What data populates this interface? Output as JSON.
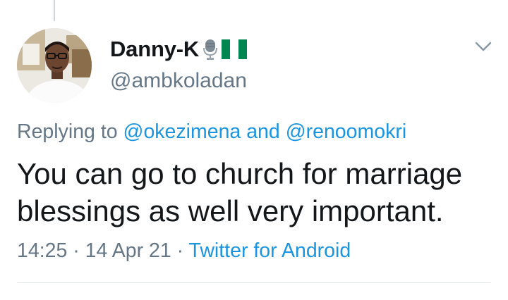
{
  "tweet": {
    "author": {
      "display_name": "Danny-K",
      "name_emojis": [
        "microphone-icon",
        "nigeria-flag-icon"
      ],
      "handle": "@ambkoladan"
    },
    "replying_prefix": "Replying to",
    "reply_to": [
      "@okezimena",
      "@renoomokri"
    ],
    "reply_connector": "and",
    "text": "You can go to church for marriage blessings as well very important.",
    "time": "14:25",
    "separator": "·",
    "date": "14 Apr 21",
    "source": "Twitter for Android"
  },
  "colors": {
    "text": "#14171a",
    "secondary": "#657786",
    "link": "#1b95e0",
    "divider": "#e1e8ed",
    "flag_green": "#008751"
  }
}
